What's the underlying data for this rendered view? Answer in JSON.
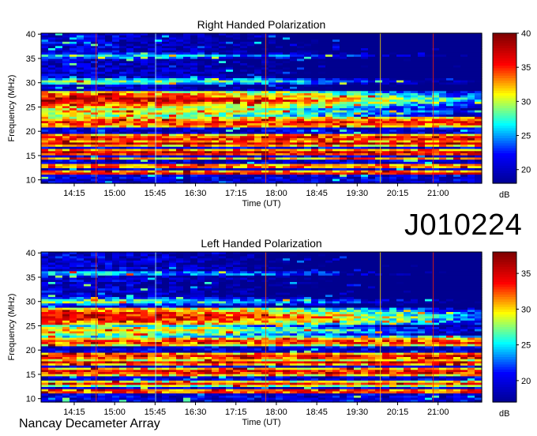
{
  "header": {
    "observation_id": "J010224",
    "footer_label": "Nancay Decameter Array"
  },
  "chart_data": [
    {
      "type": "heatmap",
      "title": "Right Handed Polarization",
      "xlabel": "Time (UT)",
      "ylabel": "Frequency (MHz)",
      "colorbar_label": "dB",
      "x_ticks": [
        "14:15",
        "15:00",
        "15:45",
        "16:30",
        "17:15",
        "18:00",
        "18:45",
        "19:30",
        "20:15",
        "21:00"
      ],
      "y_ticks": [
        10,
        15,
        20,
        25,
        30,
        35,
        40
      ],
      "ylim": [
        9.3,
        40.2
      ],
      "colorbar_ticks": [
        20,
        25,
        30,
        35,
        40
      ],
      "clim": [
        18,
        40
      ],
      "colormap": [
        "#00008f",
        "#0000ff",
        "#00ffff",
        "#ffff00",
        "#ff0000",
        "#800000"
      ],
      "bands_mhz": [
        {
          "freq": 26.5,
          "width": 1.6,
          "level": 38,
          "fade": "late"
        },
        {
          "freq": 24.0,
          "width": 1.5,
          "level": 33,
          "fade": "late"
        },
        {
          "freq": 21.8,
          "width": 1.2,
          "level": 36,
          "fade": "none"
        },
        {
          "freq": 18.6,
          "width": 0.8,
          "level": 37,
          "fade": "none"
        },
        {
          "freq": 17.5,
          "width": 0.5,
          "level": 38,
          "fade": "none"
        },
        {
          "freq": 15.6,
          "width": 0.7,
          "level": 38,
          "fade": "none"
        },
        {
          "freq": 14.4,
          "width": 0.4,
          "level": 33,
          "fade": "none"
        },
        {
          "freq": 12.8,
          "width": 0.5,
          "level": 36,
          "fade": "none"
        },
        {
          "freq": 11.4,
          "width": 0.4,
          "level": 38,
          "fade": "none"
        },
        {
          "freq": 30.2,
          "width": 0.8,
          "level": 30,
          "fade": "late"
        },
        {
          "freq": 35.5,
          "width": 0.6,
          "level": 28,
          "fade": "late"
        }
      ]
    },
    {
      "type": "heatmap",
      "title": "Left Handed Polarization",
      "xlabel": "Time (UT)",
      "ylabel": "Frequency (MHz)",
      "colorbar_label": "dB",
      "x_ticks": [
        "14:15",
        "15:00",
        "15:45",
        "16:30",
        "17:15",
        "18:00",
        "18:45",
        "19:30",
        "20:15",
        "21:00"
      ],
      "y_ticks": [
        10,
        15,
        20,
        25,
        30,
        35,
        40
      ],
      "ylim": [
        9.3,
        40.2
      ],
      "colorbar_ticks": [
        20,
        25,
        30,
        35
      ],
      "clim": [
        17,
        38
      ],
      "colormap": [
        "#00008f",
        "#0000ff",
        "#00ffff",
        "#ffff00",
        "#ff0000",
        "#800000"
      ],
      "bands_mhz": [
        {
          "freq": 26.8,
          "width": 1.8,
          "level": 36,
          "fade": "late"
        },
        {
          "freq": 24.0,
          "width": 1.4,
          "level": 31,
          "fade": "late"
        },
        {
          "freq": 21.7,
          "width": 1.0,
          "level": 34,
          "fade": "none"
        },
        {
          "freq": 18.7,
          "width": 0.8,
          "level": 35,
          "fade": "none"
        },
        {
          "freq": 17.4,
          "width": 0.5,
          "level": 36,
          "fade": "none"
        },
        {
          "freq": 15.5,
          "width": 0.7,
          "level": 36,
          "fade": "none"
        },
        {
          "freq": 13.1,
          "width": 0.5,
          "level": 34,
          "fade": "none"
        },
        {
          "freq": 11.5,
          "width": 0.4,
          "level": 36,
          "fade": "none"
        },
        {
          "freq": 30.0,
          "width": 0.8,
          "level": 28,
          "fade": "late"
        },
        {
          "freq": 35.8,
          "width": 0.6,
          "level": 27,
          "fade": "late"
        }
      ]
    }
  ]
}
